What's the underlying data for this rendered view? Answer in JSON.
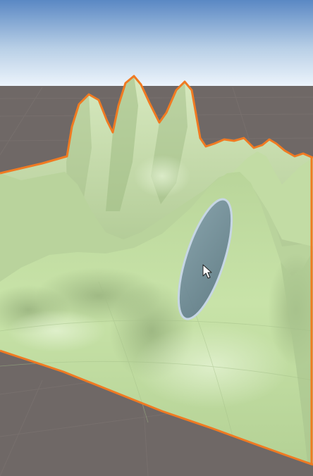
{
  "scene": {
    "colors": {
      "sky_top": "#5a88c4",
      "sky_mid": "#b5cce4",
      "sky_horizon": "#e9f2fb",
      "ground": "#6f6866",
      "grid_line": "#807875",
      "terrain_light": "#c7e2a7",
      "terrain_mid": "#a9c78a",
      "terrain_shadow": "#8ea576",
      "selection_outline": "#f07a22",
      "brush_fill": "#6f8a9a",
      "brush_outline": "#c6d6e4",
      "cursor_fill": "#ffffff",
      "cursor_stroke": "#202020"
    },
    "icons": {
      "cursor": "pointer-arrow-icon",
      "brush": "terrain-brush-ellipse-icon"
    }
  }
}
